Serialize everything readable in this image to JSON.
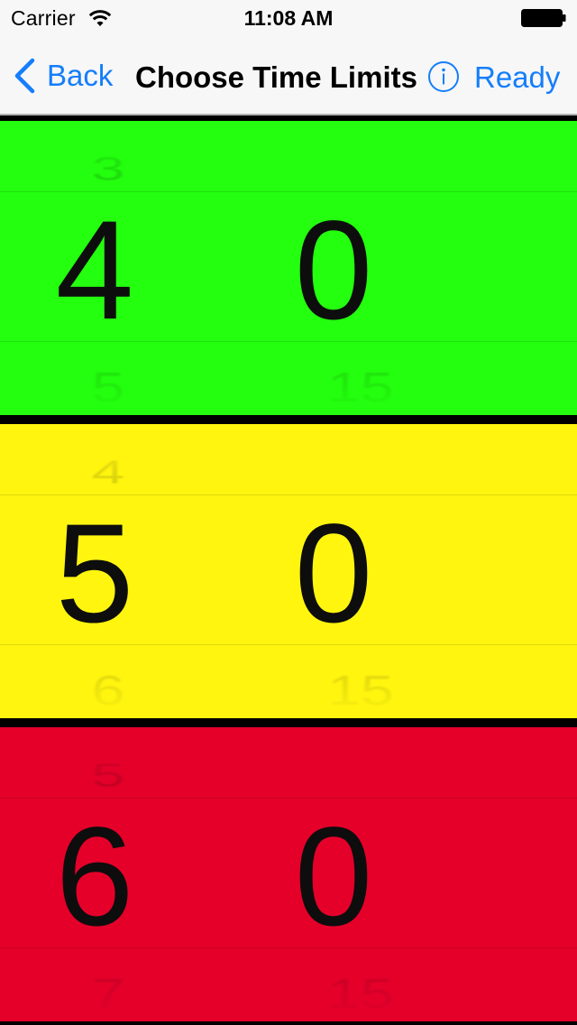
{
  "status_bar": {
    "carrier": "Carrier",
    "time": "11:08 AM",
    "wifi_icon": "wifi-icon",
    "battery_icon": "battery-icon"
  },
  "nav": {
    "back_label": "Back",
    "title": "Choose Time Limits",
    "info_icon": "info-circle-icon",
    "ready_label": "Ready",
    "tint_color": "#157efb"
  },
  "pickers": [
    {
      "name": "green",
      "color": "#23ff0e",
      "minutes": {
        "above": "3",
        "selected": "4",
        "below": "5"
      },
      "seconds": {
        "above": "",
        "selected": "0",
        "below": "15"
      }
    },
    {
      "name": "yellow",
      "color": "#fff50f",
      "minutes": {
        "above": "4",
        "selected": "5",
        "below": "6"
      },
      "seconds": {
        "above": "",
        "selected": "0",
        "below": "15"
      }
    },
    {
      "name": "red",
      "color": "#e5002a",
      "minutes": {
        "above": "5",
        "selected": "6",
        "below": "7"
      },
      "seconds": {
        "above": "",
        "selected": "0",
        "below": "15"
      }
    }
  ]
}
